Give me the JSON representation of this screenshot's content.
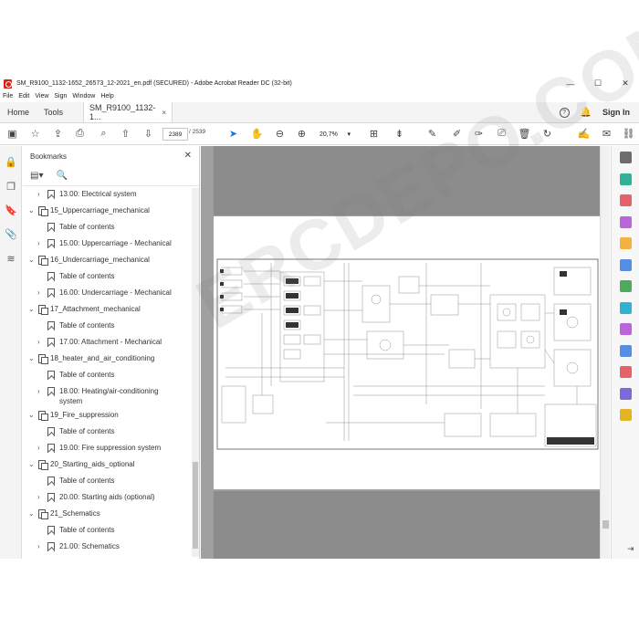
{
  "window": {
    "title": "SM_R9100_1132-1652_26573_12-2021_en.pdf (SECURED) - Adobe Acrobat Reader DC (32-bit)",
    "minimize": "—",
    "maximize": "☐",
    "close": "✕"
  },
  "menu": [
    "File",
    "Edit",
    "View",
    "Sign",
    "Window",
    "Help"
  ],
  "tabs": {
    "home": "Home",
    "tools": "Tools",
    "doc": "SM_R9100_1132-1...",
    "doc_close": "×",
    "help": "?",
    "sign_in": "Sign In"
  },
  "toolbar": {
    "page_current": "2389",
    "page_total": "/ 2539",
    "zoom": "20,7%"
  },
  "bookmarks": {
    "title": "Bookmarks",
    "close": "✕",
    "items": [
      {
        "label": "13.00: Electrical system",
        "level": 1,
        "type": "bookmark",
        "chevron": "›"
      },
      {
        "label": "15_Uppercarriage_mechanical",
        "level": 0,
        "type": "multi",
        "chevron": "⌄"
      },
      {
        "label": "Table of contents",
        "level": 1,
        "type": "bookmark",
        "chevron": ""
      },
      {
        "label": "15.00: Uppercarriage - Mechanical",
        "level": 1,
        "type": "bookmark",
        "chevron": "›"
      },
      {
        "label": "16_Undercarriage_mechanical",
        "level": 0,
        "type": "multi",
        "chevron": "⌄"
      },
      {
        "label": "Table of contents",
        "level": 1,
        "type": "bookmark",
        "chevron": ""
      },
      {
        "label": "16.00: Undercarriage - Mechanical",
        "level": 1,
        "type": "bookmark",
        "chevron": "›"
      },
      {
        "label": "17_Attachment_mechanical",
        "level": 0,
        "type": "multi",
        "chevron": "⌄"
      },
      {
        "label": "Table of contents",
        "level": 1,
        "type": "bookmark",
        "chevron": ""
      },
      {
        "label": "17.00: Attachment - Mechanical",
        "level": 1,
        "type": "bookmark",
        "chevron": "›"
      },
      {
        "label": "18_heater_and_air_conditioning",
        "level": 0,
        "type": "multi",
        "chevron": "⌄"
      },
      {
        "label": "Table of contents",
        "level": 1,
        "type": "bookmark",
        "chevron": ""
      },
      {
        "label": "18.00: Heating/air-conditioning",
        "label2": "system",
        "level": 1,
        "type": "bookmark",
        "chevron": "›"
      },
      {
        "label": "19_Fire_suppression",
        "level": 0,
        "type": "multi",
        "chevron": "⌄"
      },
      {
        "label": "Table of contents",
        "level": 1,
        "type": "bookmark",
        "chevron": ""
      },
      {
        "label": "19.00: Fire suppression system",
        "level": 1,
        "type": "bookmark",
        "chevron": "›"
      },
      {
        "label": "20_Starting_aids_optional",
        "level": 0,
        "type": "multi",
        "chevron": "⌄"
      },
      {
        "label": "Table of contents",
        "level": 1,
        "type": "bookmark",
        "chevron": ""
      },
      {
        "label": "20.00: Starting aids (optional)",
        "level": 1,
        "type": "bookmark",
        "chevron": "›"
      },
      {
        "label": "21_Schematics",
        "level": 0,
        "type": "multi",
        "chevron": "⌄"
      },
      {
        "label": "Table of contents",
        "level": 1,
        "type": "bookmark",
        "chevron": ""
      },
      {
        "label": "21.00: Schematics",
        "level": 1,
        "type": "bookmark",
        "chevron": "›"
      }
    ]
  },
  "watermark": "ERCDEPO.COM",
  "colors": {
    "accent": "#1473e6",
    "acrobat_red": "#d2261b"
  },
  "right_rail_icons": [
    {
      "name": "zoom-tool-icon",
      "color": "#555555"
    },
    {
      "name": "export-pdf-icon",
      "color": "#0ea486"
    },
    {
      "name": "create-pdf-icon",
      "color": "#e34850"
    },
    {
      "name": "edit-pdf-icon",
      "color": "#b14bd6"
    },
    {
      "name": "comment-icon",
      "color": "#f5a623"
    },
    {
      "name": "combine-files-icon",
      "color": "#3a7be0"
    },
    {
      "name": "organize-pages-icon",
      "color": "#2f9e44"
    },
    {
      "name": "scan-ocr-icon",
      "color": "#11a4c9"
    },
    {
      "name": "fill-sign-icon",
      "color": "#b14bd6"
    },
    {
      "name": "protect-icon",
      "color": "#3a7be0"
    },
    {
      "name": "redact-icon",
      "color": "#e34850"
    },
    {
      "name": "send-for-signature-icon",
      "color": "#6b4fd6"
    },
    {
      "name": "more-tools-icon",
      "color": "#e0a800"
    }
  ]
}
